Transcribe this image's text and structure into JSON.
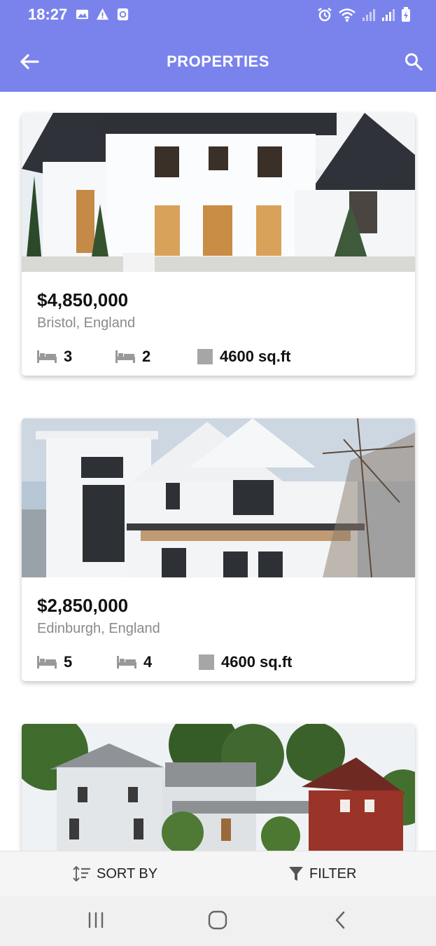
{
  "status": {
    "time": "18:27"
  },
  "appbar": {
    "title": "PROPERTIES"
  },
  "properties": [
    {
      "price": "$4,850,000",
      "location": "Bristol, England",
      "beds": "3",
      "baths": "2",
      "area": "4600 sq.ft"
    },
    {
      "price": "$2,850,000",
      "location": "Edinburgh, England",
      "beds": "5",
      "baths": "4",
      "area": "4600 sq.ft"
    },
    {
      "price": "",
      "location": "",
      "beds": "",
      "baths": "",
      "area": ""
    }
  ],
  "actions": {
    "sort_label": "SORT BY",
    "filter_label": "FILTER"
  },
  "colors": {
    "header": "#7a83ec",
    "bottom_bar": "#f5f5f5",
    "nav_bar": "#f0f0f0"
  },
  "icons": [
    "arrow-left-icon",
    "search-icon",
    "bed-icon",
    "area-icon",
    "sort-icon",
    "filter-icon",
    "recent-apps-icon",
    "home-icon",
    "back-icon"
  ]
}
